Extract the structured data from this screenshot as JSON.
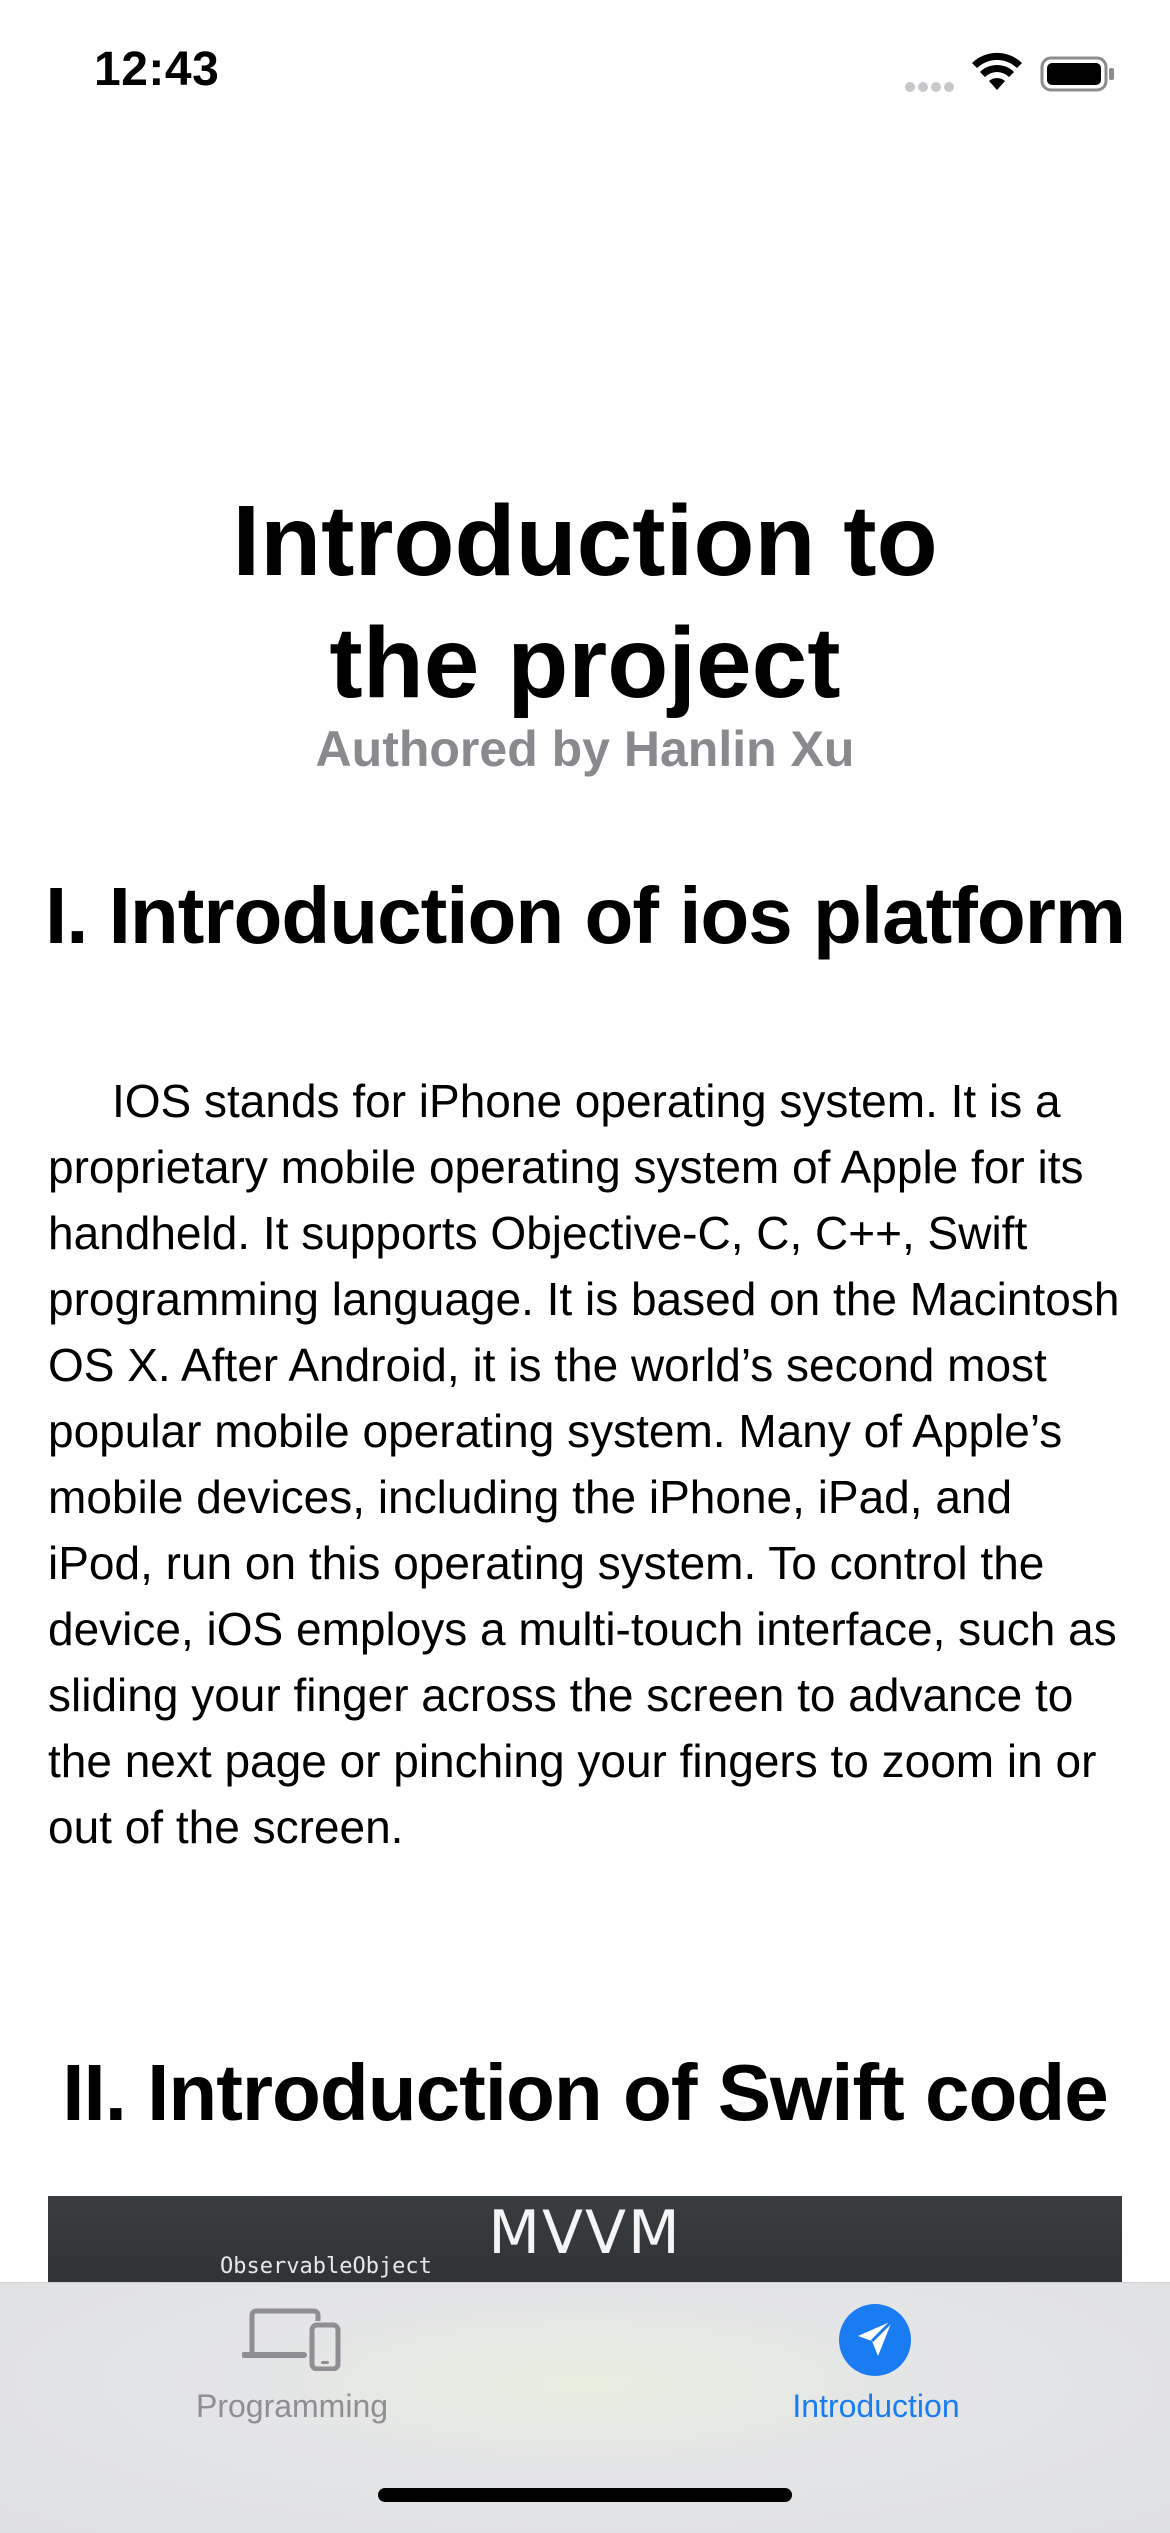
{
  "status_bar": {
    "time": "12:43",
    "icons": [
      "cellular-signal-icon",
      "wifi-icon",
      "battery-icon"
    ]
  },
  "header": {
    "title_line1": "Introduction to",
    "title_line2": "the project",
    "subtitle": "Authored by Hanlin Xu"
  },
  "sections": [
    {
      "heading": "I. Introduction of ios platform",
      "body": "IOS stands for iPhone operating system. It is a proprietary mobile operating system of Apple for its handheld. It supports Objective-C, C, C++, Swift programming language. It is based on the Macintosh OS X. After Android, it is the world’s second most popular mobile operating system. Many of Apple’s mobile devices, including the iPhone, iPad, and iPod, run on this operating system. To control the device, iOS employs a multi-touch interface, such as sliding your finger across the screen to advance to the next page or pinching your fingers to zoom in or out of the screen."
    },
    {
      "heading": "II. Introduction of Swift code",
      "image": {
        "title": "MVVM",
        "code_label": "ObservableObject"
      }
    }
  ],
  "tab_bar": {
    "tabs": [
      {
        "label": "Programming",
        "icon": "devices-icon",
        "selected": false
      },
      {
        "label": "Introduction",
        "icon": "paperplane-circle-icon",
        "selected": true
      }
    ],
    "accent_color": "#1a7cf2",
    "inactive_color": "#8e8e93"
  }
}
